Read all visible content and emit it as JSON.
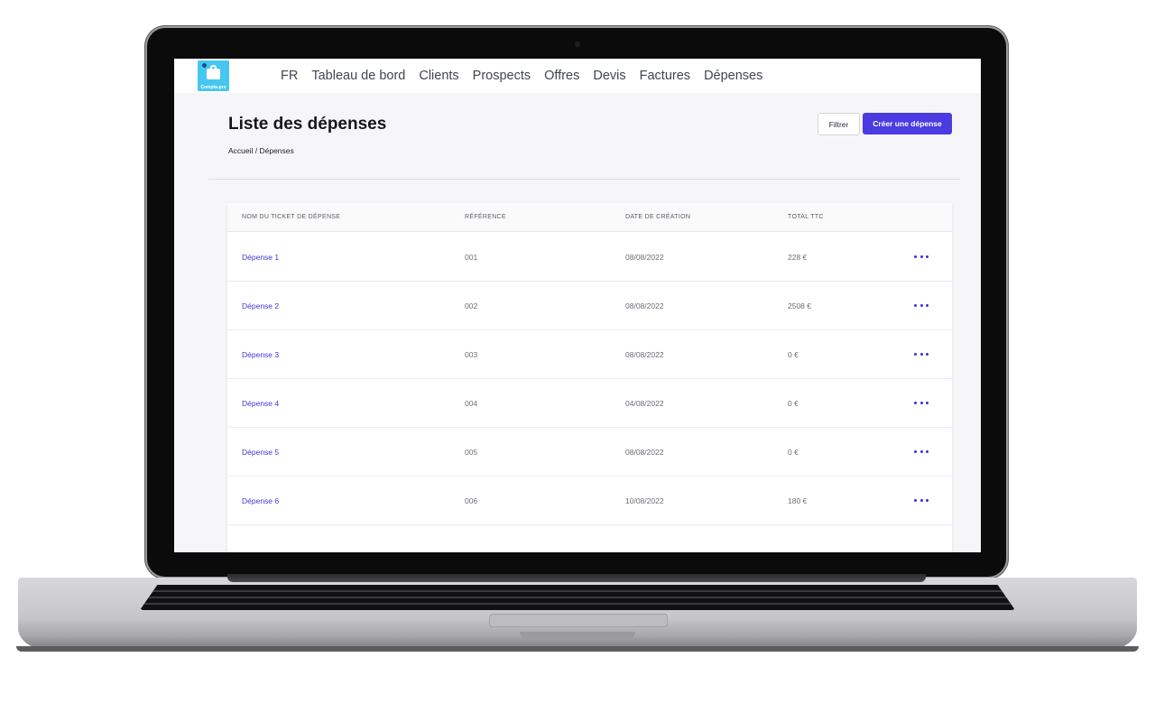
{
  "app": {
    "logo_text": "Compta-pro",
    "brand_color": "#45c7f0",
    "accent_color": "#4a3be3"
  },
  "nav": {
    "items": [
      "FR",
      "Tableau de bord",
      "Clients",
      "Prospects",
      "Offres",
      "Devis",
      "Factures",
      "Dépenses"
    ]
  },
  "page": {
    "title": "Liste des dépenses",
    "breadcrumb": "Accueil / Dépenses",
    "filter_label": "Filtrer",
    "create_label": "Créer une dépense"
  },
  "table": {
    "headers": [
      "NOM DU TICKET DE DÉPENSE",
      "RÉFÉRENCE",
      "DATE DE CRÉATION",
      "TOTAL TTC"
    ],
    "rows": [
      {
        "name": "Dépense 1",
        "ref": "001",
        "date": "08/08/2022",
        "total": "228 €"
      },
      {
        "name": "Dépense 2",
        "ref": "002",
        "date": "08/08/2022",
        "total": "2508 €"
      },
      {
        "name": "Dépense 3",
        "ref": "003",
        "date": "08/08/2022",
        "total": "0 €"
      },
      {
        "name": "Dépense 4",
        "ref": "004",
        "date": "04/08/2022",
        "total": "0 €"
      },
      {
        "name": "Dépense 5",
        "ref": "005",
        "date": "08/08/2022",
        "total": "0 €"
      },
      {
        "name": "Dépense 6",
        "ref": "006",
        "date": "10/08/2022",
        "total": "180 €"
      }
    ]
  }
}
